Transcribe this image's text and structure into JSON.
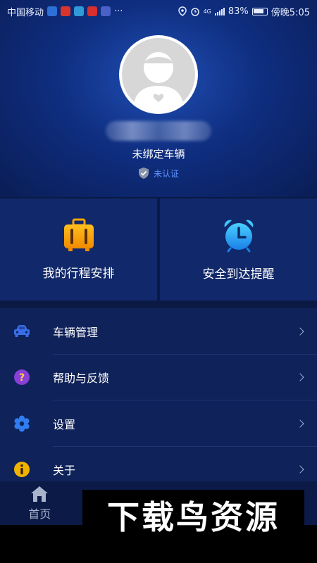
{
  "status_bar": {
    "carrier": "中国移动",
    "more": "···",
    "network": "4G",
    "battery": "83%",
    "time": "傍晚5:05"
  },
  "profile": {
    "car_status": "未绑定车辆",
    "verify_status": "未认证"
  },
  "cards": [
    {
      "label": "我的行程安排",
      "icon": "luggage-icon"
    },
    {
      "label": "安全到达提醒",
      "icon": "alarm-clock-icon"
    }
  ],
  "menu": [
    {
      "label": "车辆管理",
      "icon": "car-icon",
      "color": "#3a6ee8"
    },
    {
      "label": "帮助与反馈",
      "icon": "question-icon",
      "color": "#8a3fd6"
    },
    {
      "label": "设置",
      "icon": "gear-icon",
      "color": "#2f7df0"
    },
    {
      "label": "关于",
      "icon": "info-icon",
      "color": "#f0b400"
    }
  ],
  "tabbar": {
    "home_label": "首页"
  },
  "watermark": {
    "text": "下载鸟资源"
  },
  "colors": {
    "background": "#0a1a44",
    "accent_blue": "#5d93ff",
    "card_bg": "#11286a"
  }
}
